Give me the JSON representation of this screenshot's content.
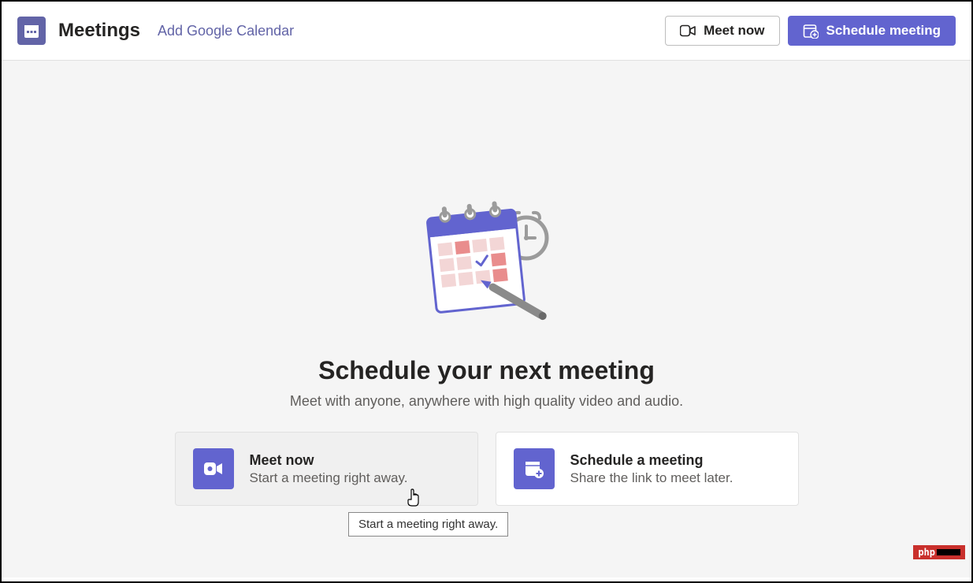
{
  "header": {
    "title": "Meetings",
    "add_calendar_link": "Add Google Calendar",
    "meet_now_btn": "Meet now",
    "schedule_btn": "Schedule meeting"
  },
  "main": {
    "heading": "Schedule your next meeting",
    "subheading": "Meet with anyone, anywhere with high quality video and audio.",
    "cards": [
      {
        "title": "Meet now",
        "subtitle": "Start a meeting right away."
      },
      {
        "title": "Schedule a meeting",
        "subtitle": "Share the link to meet later."
      }
    ]
  },
  "tooltip": "Start a meeting right away.",
  "watermark": "php",
  "colors": {
    "accent": "#6264cf",
    "accent_dark": "#6264a7"
  }
}
